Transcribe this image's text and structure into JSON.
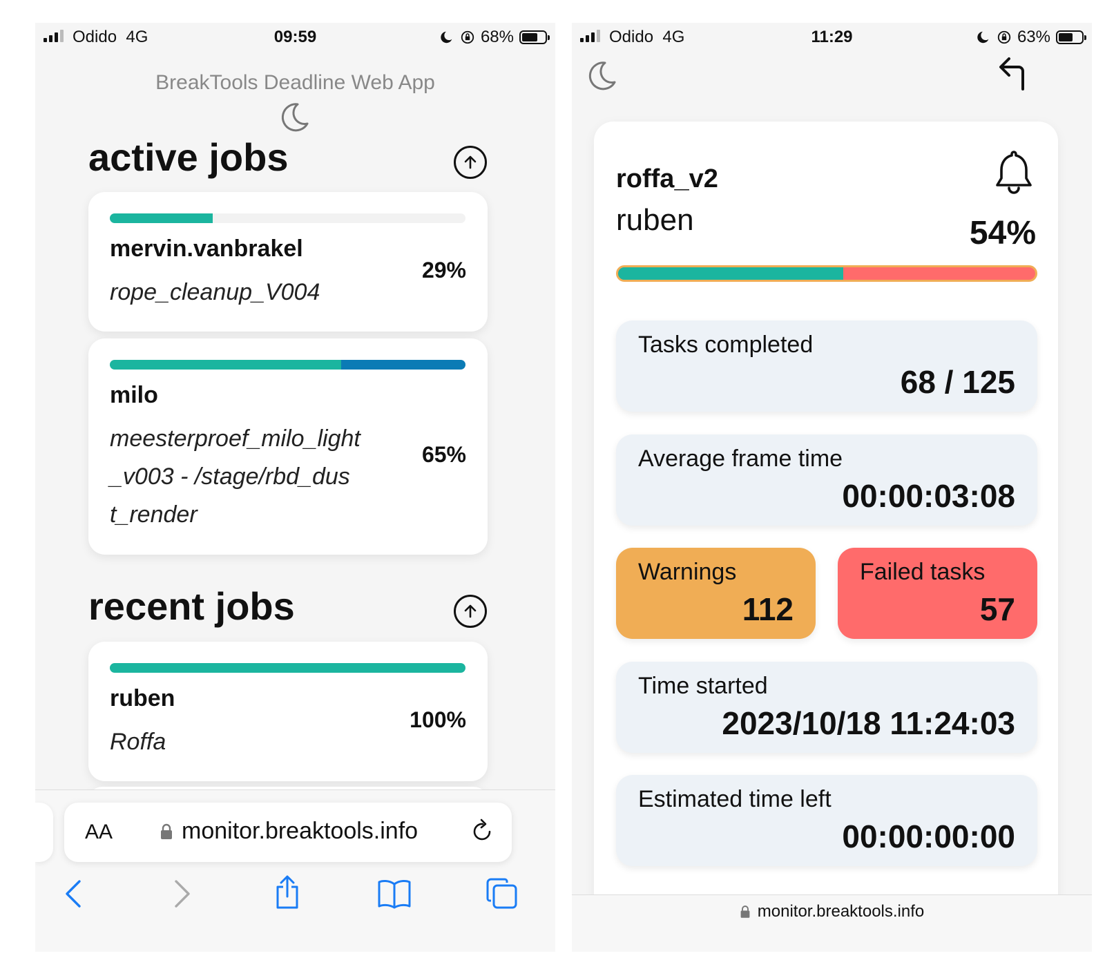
{
  "left_screen": {
    "status": {
      "carrier": "Odido",
      "network": "4G",
      "time": "09:59",
      "battery": "68%",
      "battery_level": 0.68
    },
    "app_title": "BreakTools Deadline Web App",
    "active_section": {
      "title": "active jobs"
    },
    "active_jobs": [
      {
        "user": "mervin.vanbrakel",
        "job": "rope_cleanup_V004",
        "percent": "29%",
        "progress": 0.29,
        "secondary": 0,
        "bar_color": "#1bb59f",
        "secondary_color": "#0b7bb5"
      },
      {
        "user": "milo",
        "job_lines": [
          "meesterproef_milo_light",
          "_v003 - /stage/rbd_dus",
          "t_render"
        ],
        "percent": "65%",
        "progress": 0.65,
        "secondary": 0.35,
        "bar_color": "#1bb59f",
        "secondary_color": "#0b7bb5"
      }
    ],
    "recent_section": {
      "title": "recent jobs"
    },
    "recent_jobs": [
      {
        "user": "ruben",
        "job": "Roffa",
        "percent": "100%",
        "progress": 1.0,
        "secondary": 0,
        "bar_color": "#1bb59f",
        "secondary_color": "#0b7bb5"
      }
    ],
    "browser": {
      "text_size_label": "AA",
      "url": "monitor.breaktools.info"
    }
  },
  "right_screen": {
    "status": {
      "carrier": "Odido",
      "network": "4G",
      "time": "11:29",
      "battery": "63%",
      "battery_level": 0.63
    },
    "job": "roffa_v2",
    "user": "ruben",
    "percent": "54%",
    "progress": 0.54,
    "stats": {
      "tasks_completed": {
        "label": "Tasks completed",
        "value": "68 / 125"
      },
      "average_frame_time": {
        "label": "Average frame time",
        "value": "00:00:03:08"
      },
      "warnings": {
        "label": "Warnings",
        "value": "112"
      },
      "failed_tasks": {
        "label": "Failed tasks",
        "value": "57"
      },
      "time_started": {
        "label": "Time started",
        "value": "2023/10/18 11:24:03"
      },
      "estimated_time_left": {
        "label": "Estimated time left",
        "value": "00:00:00:00"
      }
    },
    "browser": {
      "url": "monitor.breaktools.info"
    }
  },
  "colors": {
    "teal": "#1bb59f",
    "blue": "#0b7bb5",
    "orange": "#f0ad55",
    "red": "#ff6b6b",
    "card_blue": "#edf2f7",
    "ios_blue": "#1a7cf5"
  },
  "icons": [
    "signal-icon",
    "moon-icon",
    "lock-icon",
    "battery-icon",
    "arrow-up-circle-icon",
    "bell-icon",
    "back-arrow-icon",
    "reload-icon",
    "chevron-left-icon",
    "chevron-right-icon",
    "share-icon",
    "bookmarks-icon",
    "tabs-icon"
  ]
}
